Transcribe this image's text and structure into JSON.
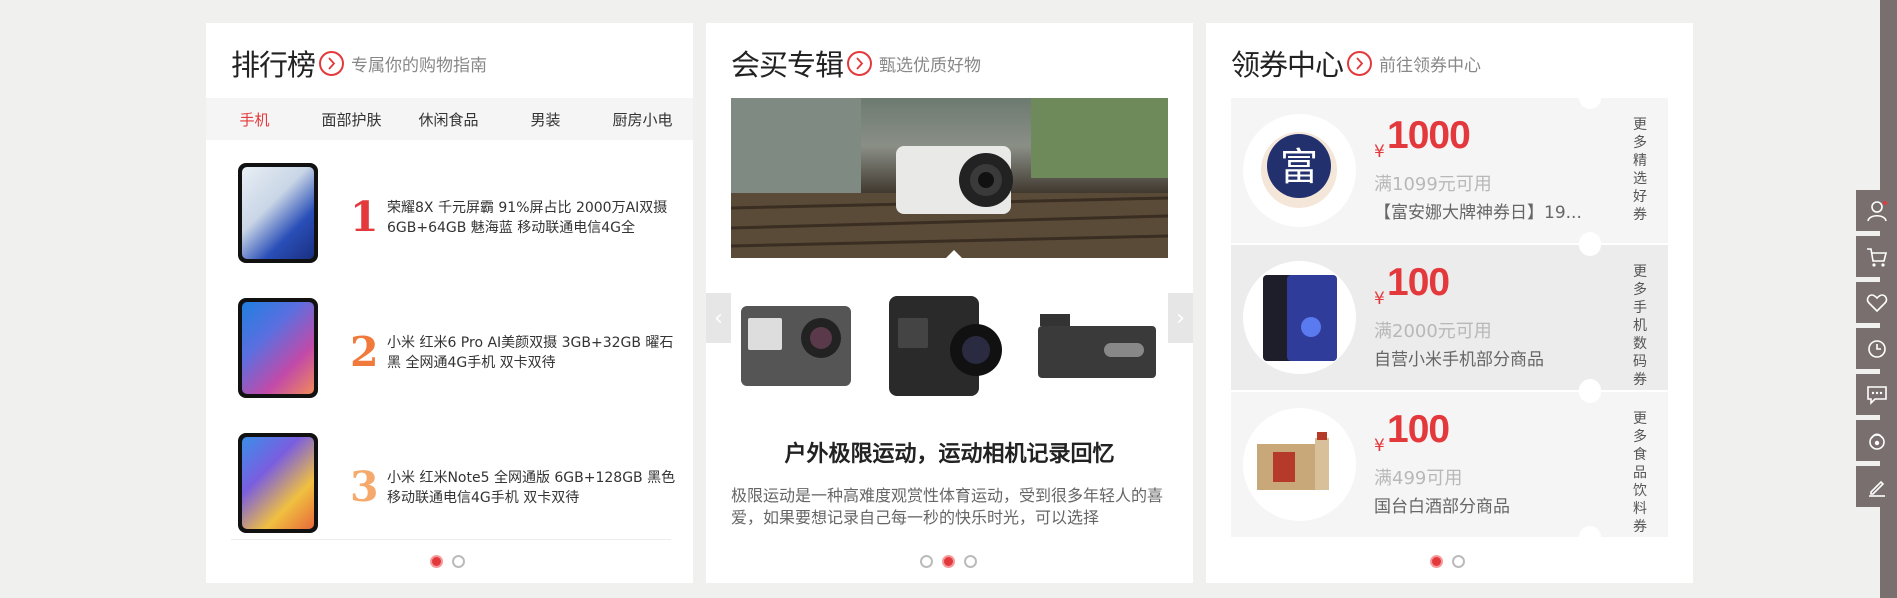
{
  "ranking": {
    "title": "排行榜",
    "subtitle": "专属你的购物指南",
    "tabs": [
      "手机",
      "面部护肤",
      "休闲食品",
      "男装",
      "厨房小电"
    ],
    "items": [
      {
        "rank": "1",
        "name": "荣耀8X 千元屏霸 91%屏占比 2000万AI双摄 6GB+64GB 魅海蓝 移动联通电信4G全",
        "rank_color": "#e4393c"
      },
      {
        "rank": "2",
        "name": "小米 红米6 Pro AI美颜双摄 3GB+32GB 曜石黑 全网通4G手机 双卡双待",
        "rank_color": "#f07a3c"
      },
      {
        "rank": "3",
        "name": "小米 红米Note5 全网通版 6GB+128GB 黑色 移动联通电信4G手机 双卡双待",
        "rank_color": "#f5a96c"
      }
    ]
  },
  "special": {
    "title": "会买专辑",
    "subtitle": "甄选优质好物",
    "heading": "户外极限运动，运动相机记录回忆",
    "description": "极限运动是一种高难度观赏性体育运动，受到很多年轻人的喜爱，如果要想记录自己每一秒的快乐时光，可以选择",
    "prev_label": "‹",
    "next_label": "›"
  },
  "coupons": {
    "title": "领券中心",
    "subtitle": "前往领券中心",
    "items": [
      {
        "yen": "¥",
        "amount": "1000",
        "condition": "满1099元可用",
        "desc": "【富安娜大牌神券日】19...",
        "more": "更多精选好券",
        "badge_char": "富"
      },
      {
        "yen": "¥",
        "amount": "100",
        "condition": "满2000元可用",
        "desc": "自营小米手机部分商品",
        "more": "更多手机数码券"
      },
      {
        "yen": "¥",
        "amount": "100",
        "condition": "满499可用",
        "desc": "国台白酒部分商品",
        "more": "更多食品饮料券"
      }
    ]
  },
  "colors": {
    "accent": "#e4393c",
    "sidebar": "#7a6f6f"
  },
  "sidebar_icons": [
    "user-icon",
    "cart-icon",
    "heart-icon",
    "history-icon",
    "message-icon",
    "service-icon",
    "edit-icon"
  ]
}
